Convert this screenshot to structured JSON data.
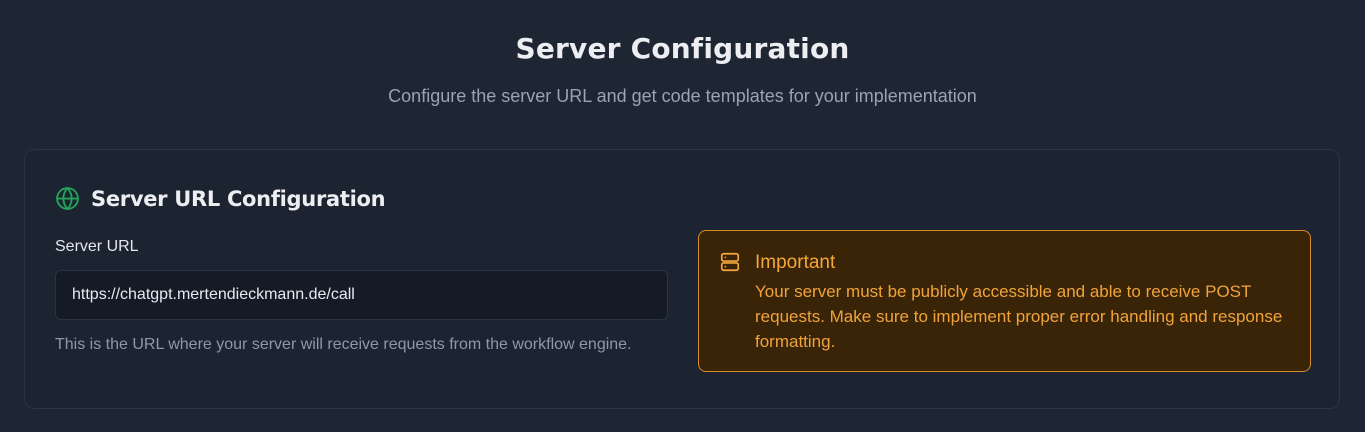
{
  "header": {
    "title": "Server Configuration",
    "subtitle": "Configure the server URL and get code templates for your implementation"
  },
  "card": {
    "title": "Server URL Configuration",
    "title_icon": "globe-icon",
    "field_label": "Server URL",
    "input_value": "https://chatgpt.mertendieckmann.de/call",
    "help_text": "This is the URL where your server will receive requests from the workflow engine."
  },
  "alert": {
    "icon": "server-icon",
    "title": "Important",
    "text": "Your server must be publicly accessible and able to receive POST requests. Make sure to implement proper error handling and response formatting."
  },
  "colors": {
    "background": "#1e2533",
    "card": "#1c2331",
    "accent_green": "#22a559",
    "warning_text": "#f5a73b",
    "warning_bg": "#3a2408",
    "warning_border": "#d78a26"
  }
}
